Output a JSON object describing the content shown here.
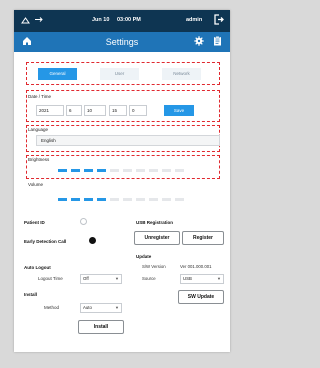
{
  "status_bar": {
    "left_icons": [
      "network-icon",
      "usb-icon"
    ],
    "date": "Jun 10",
    "time": "03:00 PM",
    "user": "admin",
    "logout_icon": "logout-icon"
  },
  "title_bar": {
    "home_icon": "home-icon",
    "title": "Settings",
    "settings_icon": "gear-icon",
    "clipboard_icon": "clipboard-icon"
  },
  "tabs": [
    {
      "label": "General",
      "active": true
    },
    {
      "label": "User",
      "active": false
    },
    {
      "label": "Network",
      "active": false
    }
  ],
  "date_time": {
    "label": "Date / Time",
    "year": "2021",
    "month": "6",
    "day": "10",
    "hour": "15",
    "minute": "0",
    "save_label": "Save"
  },
  "language": {
    "label": "Language",
    "value": "English"
  },
  "brightness": {
    "label": "Brightness",
    "level": 4,
    "steps": 10
  },
  "volume": {
    "label": "Volume",
    "level": 4,
    "steps": 10
  },
  "patient_id": {
    "label": "Patient ID",
    "checked": false
  },
  "early_detection": {
    "label": "Early Detection Call",
    "checked": true
  },
  "auto_logout": {
    "label": "Auto Logout",
    "time_label": "Logout Time",
    "time_value": "Off"
  },
  "install": {
    "label": "Install",
    "method_label": "Method",
    "method_value": "Auto",
    "button_label": "Install"
  },
  "usb_registration": {
    "label": "USB Registration",
    "unregister_label": "Unregister",
    "register_label": "Register"
  },
  "update": {
    "label": "Update",
    "sw_version_label": "S/W Version",
    "sw_version_value": "Ver 001.000.001",
    "source_label": "Source",
    "source_value": "USB",
    "button_label": "SW Update"
  },
  "colors": {
    "status_bar": "#0e3552",
    "title_bar": "#1f74b7",
    "accent": "#2597e6",
    "highlight_dash": "#e0292f"
  }
}
